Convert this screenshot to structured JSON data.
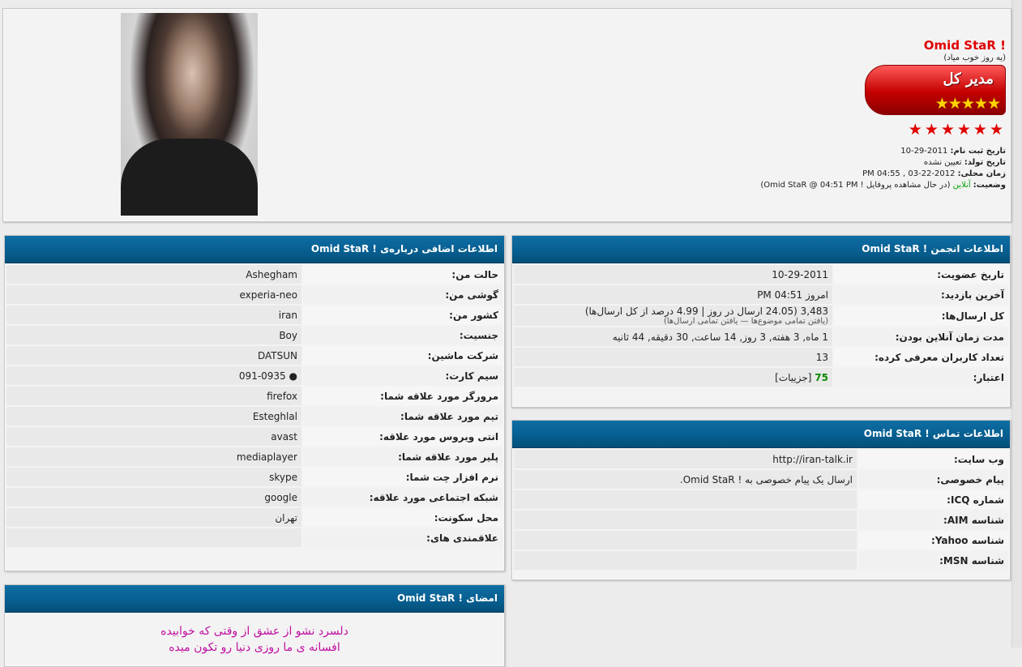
{
  "profile": {
    "username": "Omid StaR !",
    "user_title": "(یه روز خوب میاد)",
    "rank_label": "مدیر کل",
    "rank_stars": "★★★★★",
    "rep_stars": "★★★★★★",
    "join_label": "تاریخ ثبت نام:",
    "join_value": "2011-29-10",
    "birth_label": "تاریخ تولد:",
    "birth_value": "تعیین نشده",
    "local_time_label": "زمان محلی:",
    "local_time_value": "2012-22-03 , 04:55 PM",
    "status_label": "وضعیت:",
    "status_value": "آنلاین",
    "status_activity": "(در حال مشاهده پروفایل ! Omid StaR @ 04:51 PM)"
  },
  "forum_info": {
    "title": "اطلاعات انجمن ! Omid StaR",
    "rows": [
      {
        "label": "تاریخ عضویت:",
        "value": "10-29-2011"
      },
      {
        "label": "آخرین بازدید:",
        "value": "امروز 04:51 PM"
      },
      {
        "label": "کل ارسال‌ها:",
        "value": "3,483 (24.05 ارسال در روز | 4.99 درصد از کل ارسال‌ها)",
        "sub": "(یافتن تمامی موضوع‌ها — یافتن تمامی ارسال‌ها)"
      },
      {
        "label": "مدت زمان آنلاین بودن:",
        "value": "1 ماه, 3 هفته, 3 روز, 14 ساعت, 30 دقیقه, 44 ثانیه"
      },
      {
        "label": "تعداد کاربران معرفی کرده:",
        "value": "13"
      },
      {
        "label": "اعتبار:",
        "value": "75",
        "extra": "[جزییات]"
      }
    ]
  },
  "contact_info": {
    "title": "اطلاعات تماس ! Omid StaR",
    "rows": [
      {
        "label": "وب سایت:",
        "value": "http://iran-talk.ir"
      },
      {
        "label": "پیام خصوصی:",
        "value": "ارسال یک پیام خصوصی به ! Omid StaR."
      },
      {
        "label": "شماره ICQ:",
        "value": ""
      },
      {
        "label": "شناسه AIM:",
        "value": ""
      },
      {
        "label": "شناسه Yahoo:",
        "value": ""
      },
      {
        "label": "شناسه MSN:",
        "value": ""
      }
    ]
  },
  "extra_info": {
    "title": "اطلاعات اضافی درباره‌ی ! Omid StaR",
    "rows": [
      {
        "label": "حالت من:",
        "value": "Ashegham"
      },
      {
        "label": "گوشی من:",
        "value": "experia-neo"
      },
      {
        "label": "کشور من:",
        "value": "iran"
      },
      {
        "label": "جنسیت:",
        "value": "Boy"
      },
      {
        "label": "شرکت ماشین:",
        "value": "DATSUN"
      },
      {
        "label": "سیم کارت:",
        "value": "● 091-0935"
      },
      {
        "label": "مرورگر مورد علاقه شما:",
        "value": "firefox"
      },
      {
        "label": "تیم مورد علاقه شما:",
        "value": "Esteghlal"
      },
      {
        "label": "انتی ویروس مورد علاقه:",
        "value": "avast"
      },
      {
        "label": "پلیر مورد علاقه شما:",
        "value": "mediaplayer"
      },
      {
        "label": "نرم افزار چت شما:",
        "value": "skype"
      },
      {
        "label": "شبکه اجتماعی مورد علاقه:",
        "value": "google"
      },
      {
        "label": "محل سکونت:",
        "value": "تهران"
      },
      {
        "label": "علاقمندی های:",
        "value": ""
      }
    ]
  },
  "signature": {
    "title": "امضای ! Omid StaR",
    "line1": "دلسرد نشو از عشق از وقتی که خوابیده",
    "line2": "افسانه ی ما روزی دنیا رو تکون میده"
  }
}
